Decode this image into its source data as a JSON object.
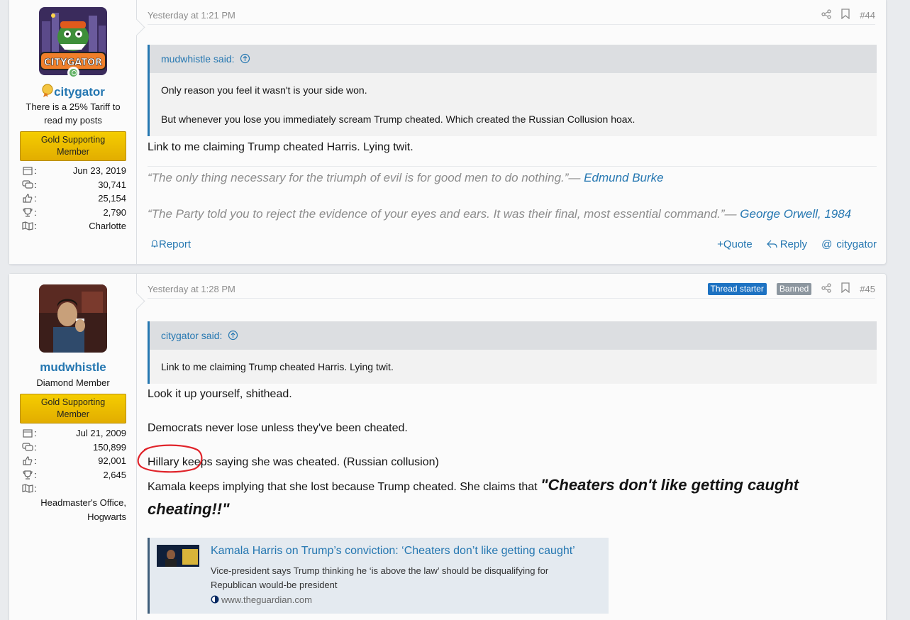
{
  "colors": {
    "accent": "#2577b1",
    "gold": "#f5cd00",
    "online": "#63b265",
    "thread_starter": "#1d72c2",
    "banned": "#8c969f",
    "annotation": "#e0232a"
  },
  "posts": [
    {
      "user": {
        "name": "citygator",
        "avatar_text": "CITYGATOR",
        "title_lines": [
          "There is a 25% Tariff to",
          "read my posts"
        ],
        "banner_lines": [
          "Gold Supporting",
          "Member"
        ],
        "stats": {
          "joined": "Jun 23, 2019",
          "messages": "30,741",
          "reactions": "25,154",
          "points": "2,790",
          "location": "Charlotte"
        }
      },
      "date": "Yesterday at 1:21 PM",
      "number": "#44",
      "quote": {
        "author": "mudwhistle said:",
        "lines": [
          "Only reason you feel it wasn't is your side won.",
          "But whenever you lose you immediately scream Trump cheated. Which created the Russian Collusion hoax."
        ]
      },
      "message": "Link to me claiming Trump cheated Harris. Lying twit.",
      "signature": [
        {
          "text": "“The only thing necessary for the triumph of evil is for good men to do nothing.”— ",
          "link": "Edmund Burke"
        },
        {
          "text": "“The Party told you to reject the evidence of your eyes and ears. It was their final, most essential command.”— ",
          "link": "George Orwell, 1984"
        }
      ],
      "actions": {
        "report": "Report",
        "quote": "Quote",
        "reply": "Reply",
        "mention": "citygator"
      }
    },
    {
      "user": {
        "name": "mudwhistle",
        "title": "Diamond Member",
        "banner_lines": [
          "Gold Supporting",
          "Member"
        ],
        "stats": {
          "joined": "Jul 21, 2009",
          "messages": "150,899",
          "reactions": "92,001",
          "points": "2,645",
          "location_lines": [
            "Headmaster's Office,",
            "Hogwarts"
          ]
        }
      },
      "date": "Yesterday at 1:28 PM",
      "badges": {
        "starter": "Thread starter",
        "banned": "Banned"
      },
      "number": "#45",
      "quote": {
        "author": "citygator said:",
        "lines": [
          "Link to me claiming Trump cheated Harris. Lying twit."
        ]
      },
      "message": {
        "p1": "Look it up yourself, shithead.",
        "p2": "Democrats never lose unless they've been cheated.",
        "p3": "Hillary keeps saying she was cheated. (Russian collusion)",
        "p4": "Kamala keeps implying that she lost because Trump cheated. She claims that ",
        "p4_bold_a": "\"Cheaters don't like getting caught",
        "p4_bold_b": "cheating!!\""
      },
      "unfurl": {
        "title": "Kamala Harris on Trump’s conviction: ‘Cheaters don’t like getting caught’",
        "desc": "Vice-president says Trump thinking he ‘is above the law’ should be disqualifying for Republican would-be president",
        "domain": "www.theguardian.com"
      }
    }
  ]
}
